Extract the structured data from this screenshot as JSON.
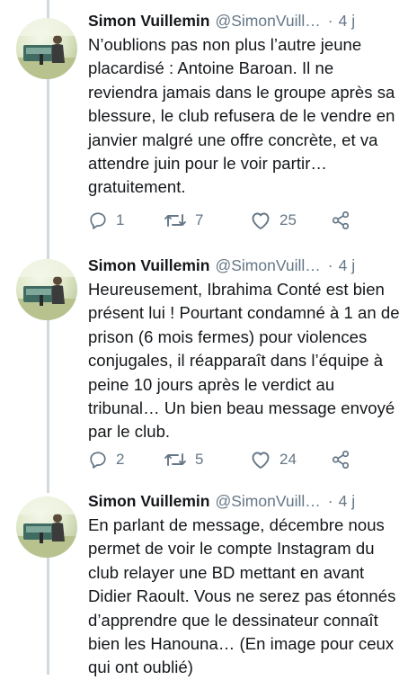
{
  "tweets": [
    {
      "name": "Simon Vuillemin",
      "handle": "@SimonVuill…",
      "dot": "·",
      "time": "4 j",
      "text": "N’oublions pas non plus l’autre jeune placardisé : Antoine Baroan. Il ne reviendra jamais dans le groupe après sa blessure, le club refusera de le vendre en janvier malgré une offre concrète, et va attendre juin pour le voir partir… gratuitement.",
      "replies": "1",
      "retweets": "7",
      "likes": "25"
    },
    {
      "name": "Simon Vuillemin",
      "handle": "@SimonVuill…",
      "dot": "·",
      "time": "4 j",
      "text": "Heureusement, Ibrahima Conté est bien présent lui ! Pourtant condamné à 1 an de prison (6 mois fermes) pour violences conjugales, il réapparaît dans l’équipe à peine 10 jours après le verdict au tribunal… Un bien beau message envoyé par le club.",
      "replies": "2",
      "retweets": "5",
      "likes": "24"
    },
    {
      "name": "Simon Vuillemin",
      "handle": "@SimonVuill…",
      "dot": "·",
      "time": "4 j",
      "text": "En parlant de message, décembre nous permet de voir le compte Instagram du club relayer une BD mettant en avant Didier Raoult. Vous ne serez pas étonnés d’apprendre que le dessinateur connaît bien les Hanouna… (En image pour ceux qui ont oublié)"
    }
  ],
  "colors": {
    "text": "#14171a",
    "secondary": "#657786",
    "thread_line": "#cfd9de",
    "divider": "#e1e8ed"
  },
  "icons": {
    "reply": "reply-icon",
    "retweet": "retweet-icon",
    "like": "heart-icon",
    "share": "share-icon"
  }
}
